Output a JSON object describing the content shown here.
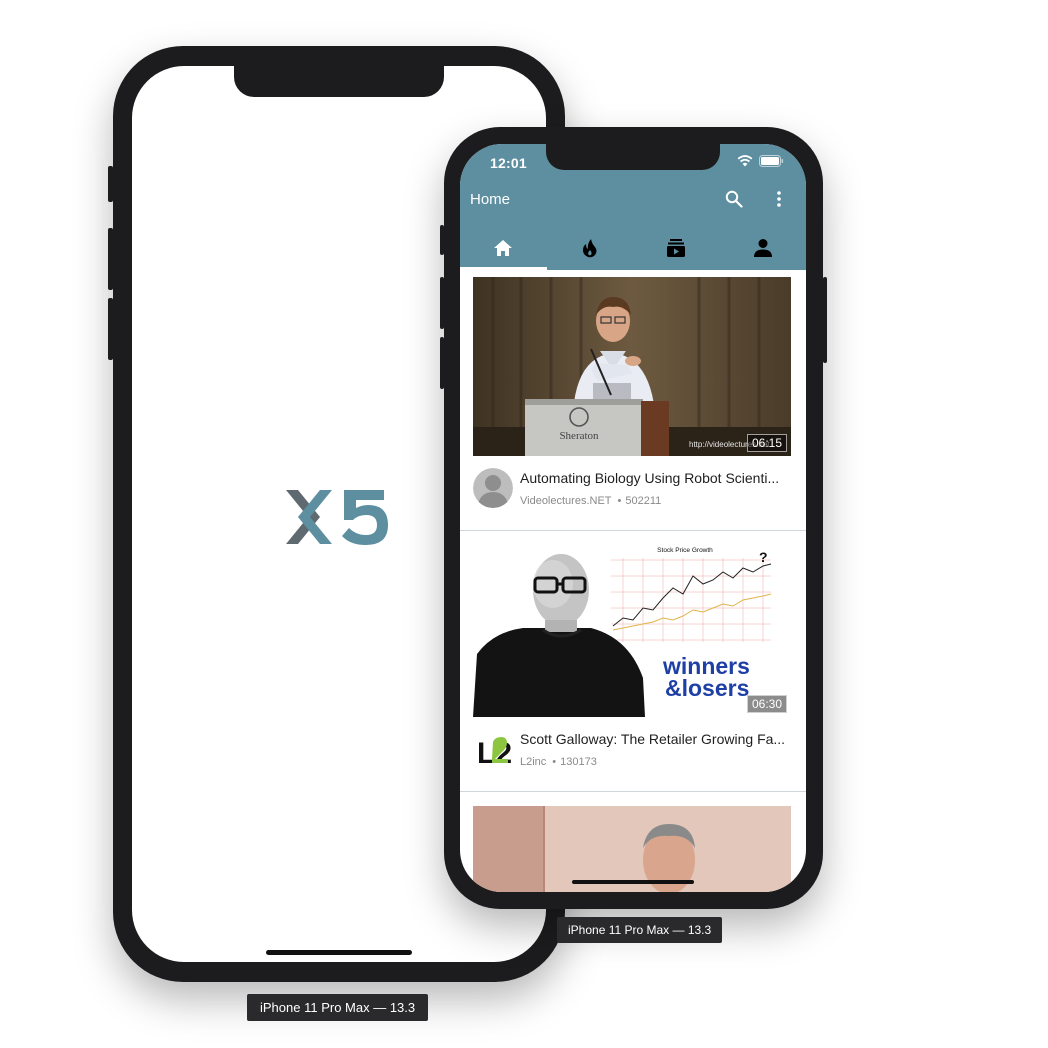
{
  "back_device": {
    "simulator_label": "iPhone 11 Pro Max — 13.3",
    "splash_logo": "x5-logo"
  },
  "front_device": {
    "simulator_label": "iPhone 11 Pro Max — 13.3",
    "status_bar": {
      "time": "12:01",
      "icons": [
        "wifi-icon",
        "battery-icon"
      ]
    },
    "header": {
      "title": "Home",
      "actions": [
        "search-icon",
        "more-vertical-icon"
      ]
    },
    "tabs": [
      {
        "name": "home",
        "icon": "home-icon",
        "active": true
      },
      {
        "name": "trending",
        "icon": "fire-icon",
        "active": false
      },
      {
        "name": "subscriptions",
        "icon": "subscriptions-icon",
        "active": false
      },
      {
        "name": "account",
        "icon": "person-icon",
        "active": false
      }
    ],
    "videos": [
      {
        "title": "Automating Biology Using Robot Scienti...",
        "channel": "Videolectures.NET",
        "views": "502211",
        "duration": "06:15",
        "thumb_watermark": "http://videolectures.net",
        "podium_text": "Sheraton"
      },
      {
        "title": "Scott Galloway: The Retailer Growing Fa...",
        "channel": "L2inc",
        "views": "130173",
        "duration": "06:30",
        "chart_title": "Stock Price Growth",
        "overlay_text_1": "winners",
        "overlay_text_2": "&losers",
        "channel_logo_text": "L2"
      },
      {
        "title": "",
        "channel": "",
        "views": "",
        "duration": ""
      }
    ],
    "colors": {
      "header": "#5d8fa1",
      "accent": "#5d8fa1",
      "text_primary": "#1f1f1f",
      "text_secondary": "#8a8a8a"
    }
  }
}
